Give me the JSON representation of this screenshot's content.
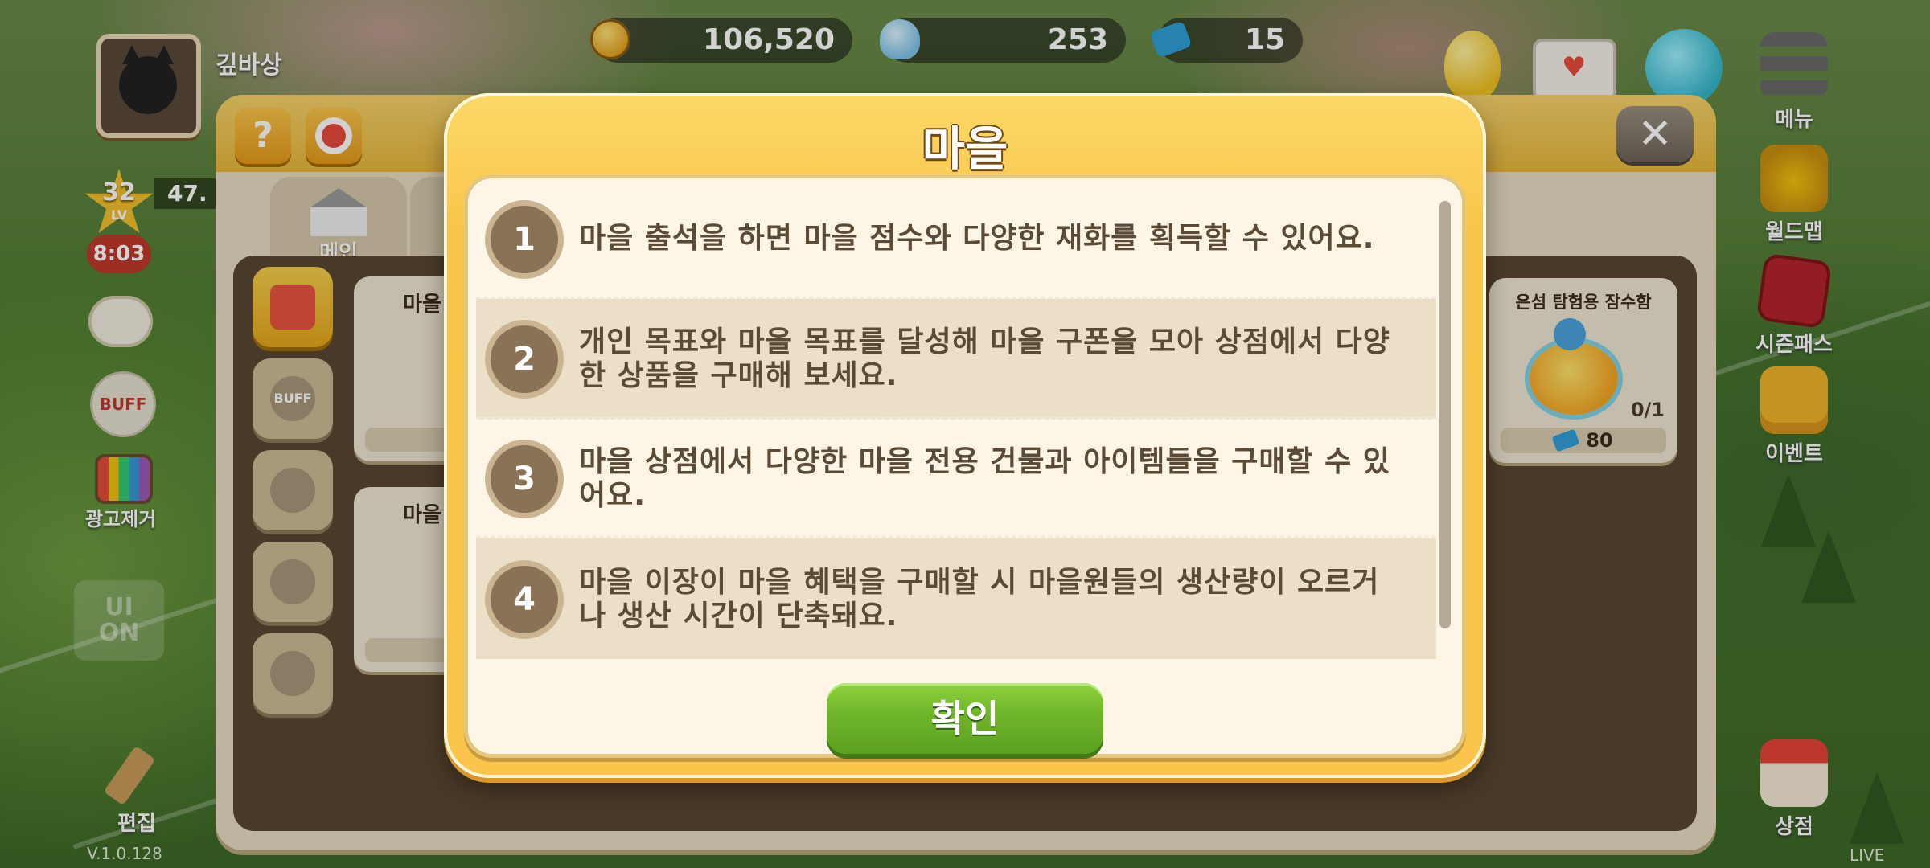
{
  "hud": {
    "player_name": "깊바상",
    "level": "32",
    "level_sub": "LV",
    "xp_partial": "47.",
    "timer": "8:03",
    "buff_label": "BUFF",
    "ad_remove_label": "광고제거",
    "ui_toggle": "UI\nON",
    "edit_label": "편집",
    "version": "V.1.0.128",
    "live_label": "LIVE"
  },
  "currency": {
    "gold": "106,520",
    "bells": "253",
    "tickets": "15"
  },
  "right_menu": {
    "menu": "메뉴",
    "world_map": "월드맵",
    "season_pass": "시즌패스",
    "event": "이벤트",
    "shop": "상점"
  },
  "village_panel": {
    "help_label": "?",
    "close_label": "✕",
    "tab_main": "메인",
    "card1_title": "마을",
    "card2_title": "마을",
    "right_card_title": "은섬 탐험용 잠수함",
    "right_card_count": "0/1",
    "right_card_price": "80"
  },
  "modal": {
    "title": "마을",
    "items": [
      {
        "number": "1",
        "text": "마을 출석을 하면 마을 점수와 다양한 재화를 획득할 수 있어요."
      },
      {
        "number": "2",
        "text": "개인 목표와 마을 목표를 달성해 마을 구폰을 모아 상점에서 다양한 상품을 구매해 보세요."
      },
      {
        "number": "3",
        "text": "마을 상점에서 다양한 마을 전용 건물과 아이템들을 구매할 수 있어요."
      },
      {
        "number": "4",
        "text": "마을 이장이 마을 혜택을 구매할 시 마을원들의 생산량이 오르거나 생산 시간이 단축돼요."
      }
    ],
    "confirm_label": "확인"
  }
}
